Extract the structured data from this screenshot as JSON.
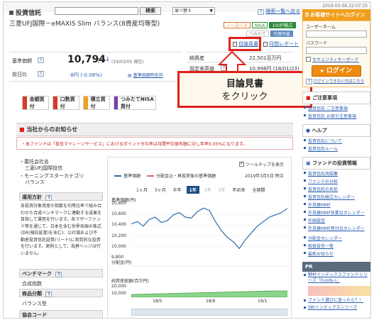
{
  "timestamp": "2019-03-06 22:07:15",
  "header": {
    "brand": "投資信託",
    "search_button": "検索",
    "sort_value": "並べ替え",
    "search_help_link": "検索一覧へ戻る"
  },
  "fund": {
    "name": "三菱UFJ国際－eMAXIS Slim バランス(8資産均等型)",
    "tags": [
      "ノーロード",
      "NISA",
      "つみたて",
      "100円積立",
      "代理可能"
    ],
    "links": {
      "prospectus": "目論見書",
      "monthly_report": "月間レポート"
    },
    "nav_label": "基準価額",
    "nav_value": "10,794",
    "nav_unit": "円",
    "nav_date": "(19/03/05 現在)",
    "prev_day_label": "前日比",
    "prev_day_value": "-8円 (-0.08%)",
    "nav_history_link": "基準価額時系列",
    "net_assets_label": "純資産",
    "net_assets_value": "22,501百万円",
    "set_high_label": "設定来高値",
    "set_high_value": "10,998円 (18/01/23)"
  },
  "callout": {
    "line1": "目論見書",
    "line2": "をクリック"
  },
  "actions": [
    {
      "label": "金額買付",
      "color": "#d93b2b"
    },
    {
      "label": "口数買付",
      "color": "#d93b2b"
    },
    {
      "label": "積立買付",
      "color": "#f0a020"
    },
    {
      "label": "つみたてNISA買付",
      "color": "#7a3fb0"
    }
  ],
  "notice": {
    "title": "当社からのお知らせ",
    "text": "・本ファンドは「投信マイレージサービス」におけるポイント付与率は月間平均保有額に対し年率0.05%になります。"
  },
  "info": {
    "trust_company_label": "・委託会社名",
    "trust_company_value": "三菱UFJ国際投信",
    "category_label": "・モーニングスターカテゴリ",
    "category_value": "バランス",
    "policy_title": "運用方針",
    "policy_text": "各投資対象資産の指数を均等比率で組み合わせた合成ベンチマークに連動する成果を目指して運用を行います。各マザーファンド等を通じて、日本を含む世界各国の株式(DR(預託証書)を含む)、公社債および不動産投資信託証券(リート)に実質的な投資を行います。原則として、為替ヘッジは行いません。",
    "benchmark_title": "ベンチマーク",
    "benchmark_value": "合成指数",
    "category_title": "商品分類",
    "category_item": "バランス型",
    "code_title": "協会コード"
  },
  "chart": {
    "tooltip_label": "ツールチップを表示",
    "legend_nav": "基準価額",
    "legend_reinvest": "分配金込・再投資後の基準価額",
    "date_label": "2019年3月5日 時点",
    "periods": [
      "1ヶ月",
      "3ヶ月",
      "半年",
      "1年",
      "3年",
      "5年",
      "年初来",
      "全期間"
    ],
    "active_period": "1年",
    "panel_nav": "基準価額(円)",
    "panel_dist": "分配金(円)",
    "panel_assets": "純資産総額(百万円)",
    "y_ticks": [
      "10,800",
      "10,600",
      "10,400",
      "10,200",
      "10,000",
      "9,800"
    ],
    "asset_ticks": [
      "20,000",
      "10,000"
    ],
    "x_ticks": [
      "18/5",
      "18/9",
      "19/1"
    ]
  },
  "chart_data": {
    "type": "line",
    "title": "",
    "ylabel": "基準価額(円)",
    "ylim": [
      9700,
      10900
    ],
    "series": [
      {
        "name": "基準価額",
        "values": [
          10450,
          10500,
          10400,
          10550,
          10600,
          10480,
          10520,
          10650,
          10700,
          10600,
          10580,
          10720,
          10800,
          10750,
          10500,
          10300,
          10150,
          10050,
          9900,
          10100,
          10250,
          10400,
          10500,
          10600,
          10650,
          10700,
          10794
        ]
      }
    ]
  },
  "sidebar": {
    "login_title": "お客様サイトへログイン",
    "username_label": "ユーザーネーム",
    "password_label": "パスワード",
    "security_link": "セキュリティキーボード",
    "login_button": "ログイン",
    "login_help": "ログインできない方はこちら",
    "attention_title": "ご注意事項",
    "attention_links": [
      "投資信託 ご注意事項",
      "投資信託 お取引注意事項"
    ],
    "help_title": "ヘルプ",
    "help_links": [
      "投資信託について",
      "投資信託ルール"
    ],
    "tools_title": "ファンドの投資情報",
    "tools_links": [
      "投資信託用語集",
      "ファンドの分析",
      "投資信託の名前",
      "投資信託積立カレンダー",
      "外貨建MMF",
      "外貨建MMF休業日カレンダー",
      "外国投信",
      "外貨建MMF買付日カレンダー"
    ],
    "tools_links2": [
      "分配金カレンダー",
      "取扱投信一覧",
      "最新お知らせ"
    ],
    "pr_title": "PR",
    "pr_items": [
      "野村インデックスファンドシリーズ「Funds-i」",
      "ファンド選びに迷ったら？！",
      "SBIインデックスシリーズ"
    ]
  }
}
